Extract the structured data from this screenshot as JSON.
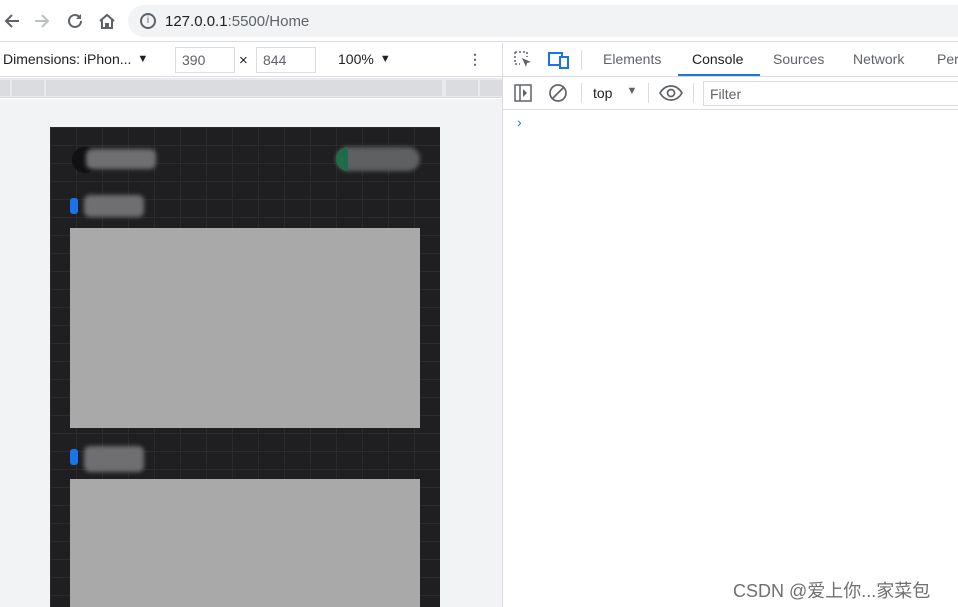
{
  "browser": {
    "url_host": "127.0.0.1",
    "url_path": ":5500/Home"
  },
  "device_toolbar": {
    "dimensions_label": "Dimensions: iPhon...",
    "width": "390",
    "times": "×",
    "height": "844",
    "zoom": "100%"
  },
  "phone": {
    "card_numbers": [
      "1",
      "2"
    ]
  },
  "devtools": {
    "tabs": [
      "Elements",
      "Console",
      "Sources",
      "Network",
      "Per"
    ],
    "active_tab": "Console",
    "context": "top",
    "filter_placeholder": "Filter",
    "prompt": "›"
  },
  "watermark": "CSDN @爱上你...家菜包",
  "colors": {
    "accent": "#1a73e8",
    "card": "#a9a9a9",
    "phone_bg": "#1f1f21"
  }
}
